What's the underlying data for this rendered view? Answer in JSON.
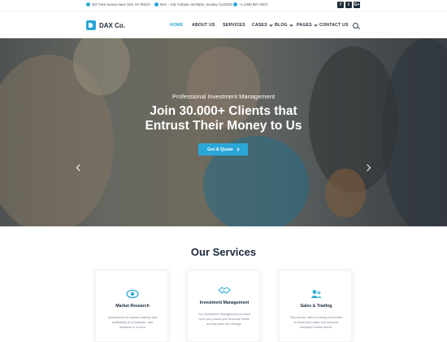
{
  "topbar": {
    "address": "267 Park Avenue New York, NY 90210",
    "hours": "Mon – Sat: 9:00am–18:00pm, Sunday CLOSED",
    "phone": "+1 (409) 987–5874",
    "social": [
      {
        "icon": "facebook-icon",
        "glyph": "f"
      },
      {
        "icon": "twitter-icon",
        "glyph": "t"
      },
      {
        "icon": "googleplus-icon",
        "glyph": "G+"
      }
    ]
  },
  "brand": {
    "name": "DAX Co."
  },
  "nav": {
    "items": [
      {
        "label": "HOME",
        "active": true
      },
      {
        "label": "ABOUT US"
      },
      {
        "label": "SERVICES"
      },
      {
        "label": "CASES"
      },
      {
        "label": "BLOG"
      },
      {
        "label": "PAGES"
      },
      {
        "label": "CONTACT US"
      }
    ]
  },
  "hero": {
    "subtitle": "Professional Investment Management",
    "title_line1": "Join 30.000+ Clients that",
    "title_line2": "Entrust Their Money to Us",
    "cta_label": "Get A Quote"
  },
  "services": {
    "title": "Our Services",
    "cards": [
      {
        "title": "Market Research",
        "icon": "eye-icon",
        "desc": "Assessment of markets stability and profitability of a business, was business in a more"
      },
      {
        "title": "Investment Management",
        "icon": "handshake-icon",
        "desc": "Our Investment Management we more how you pursue your financial needs as they grow and change."
      },
      {
        "title": "Sales & Trading",
        "icon": "users-icon",
        "desc": "This service offers a variety of benefits to boost your sales and suit your company's finest needs."
      }
    ]
  },
  "colors": {
    "accent": "#2aa7d8",
    "dark": "#1b2a3a"
  }
}
